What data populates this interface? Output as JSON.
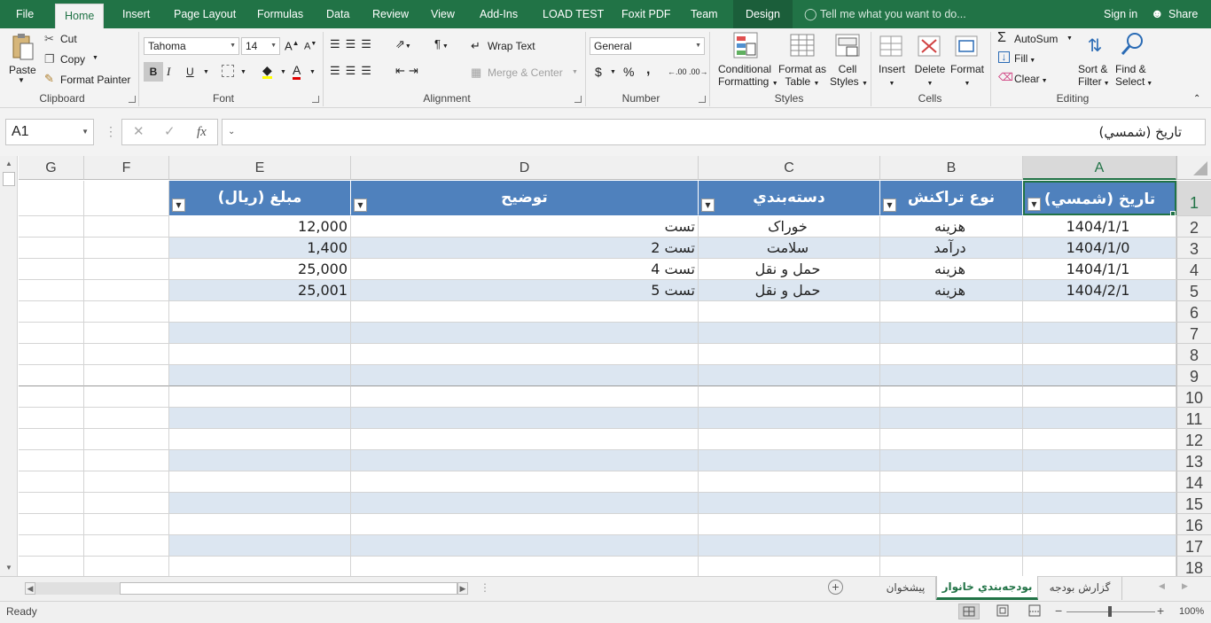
{
  "menu": {
    "file": "File",
    "home": "Home",
    "insert": "Insert",
    "page_layout": "Page Layout",
    "formulas": "Formulas",
    "data": "Data",
    "review": "Review",
    "view": "View",
    "addins": "Add-Ins",
    "load_test": "LOAD TEST",
    "foxit": "Foxit PDF",
    "team": "Team",
    "design": "Design",
    "tell_me": "Tell me what you want to do...",
    "sign_in": "Sign in",
    "share": "Share"
  },
  "ribbon": {
    "clipboard": {
      "paste": "Paste",
      "cut": "Cut",
      "copy": "Copy",
      "format_painter": "Format Painter",
      "label": "Clipboard"
    },
    "font": {
      "name": "Tahoma",
      "size": "14",
      "bold": "B",
      "italic": "I",
      "underline": "U",
      "label": "Font"
    },
    "alignment": {
      "wrap_text": "Wrap Text",
      "merge_center": "Merge & Center",
      "label": "Alignment"
    },
    "number": {
      "format": "General",
      "currency": "$",
      "percent": "%",
      "comma": ",",
      "label": "Number"
    },
    "styles": {
      "conditional": "Conditional",
      "formatting": "Formatting",
      "format_as": "Format as",
      "table": "Table",
      "cell": "Cell",
      "cell_styles": "Styles",
      "label": "Styles"
    },
    "cells": {
      "insert": "Insert",
      "delete": "Delete",
      "format": "Format",
      "label": "Cells"
    },
    "editing": {
      "autosum": "AutoSum",
      "fill": "Fill",
      "clear": "Clear",
      "sort": "Sort &",
      "filter": "Filter",
      "find": "Find &",
      "select": "Select",
      "label": "Editing"
    }
  },
  "formula_bar": {
    "name_box": "A1",
    "fx": "fx",
    "content": "تاريخ (شمسي)"
  },
  "columns": [
    "A",
    "B",
    "C",
    "D",
    "E",
    "F",
    "G"
  ],
  "row_numbers": [
    "1",
    "2",
    "3",
    "4",
    "5",
    "6",
    "7",
    "8",
    "9",
    "10",
    "11",
    "12",
    "13",
    "14",
    "15",
    "16",
    "17",
    "18"
  ],
  "table": {
    "headers": [
      "تاريخ (شمسي)",
      "نوع تراکنش",
      "دسته‌بندي",
      "توضيح",
      "مبلغ (ريال)"
    ],
    "rows": [
      [
        "1404/1/1",
        "هزينه",
        "خوراک",
        "تست",
        "12,000"
      ],
      [
        "1404/1/0",
        "درآمد",
        "سلامت",
        "تست 2",
        "1,400"
      ],
      [
        "1404/1/1",
        "هزينه",
        "حمل و نقل",
        "تست 4",
        "25,000"
      ],
      [
        "1404/2/1",
        "هزينه",
        "حمل و نقل",
        "تست 5",
        "25,001"
      ]
    ]
  },
  "sheets": {
    "tab1": "گزارش بودجه",
    "tab2": "بودجه‌بندي خانوار",
    "tab3": "پيشخوان"
  },
  "status": {
    "ready": "Ready",
    "zoom": "100%"
  },
  "colors": {
    "accent": "#217346",
    "table_header": "#4f81bd",
    "band": "#dce6f1"
  }
}
